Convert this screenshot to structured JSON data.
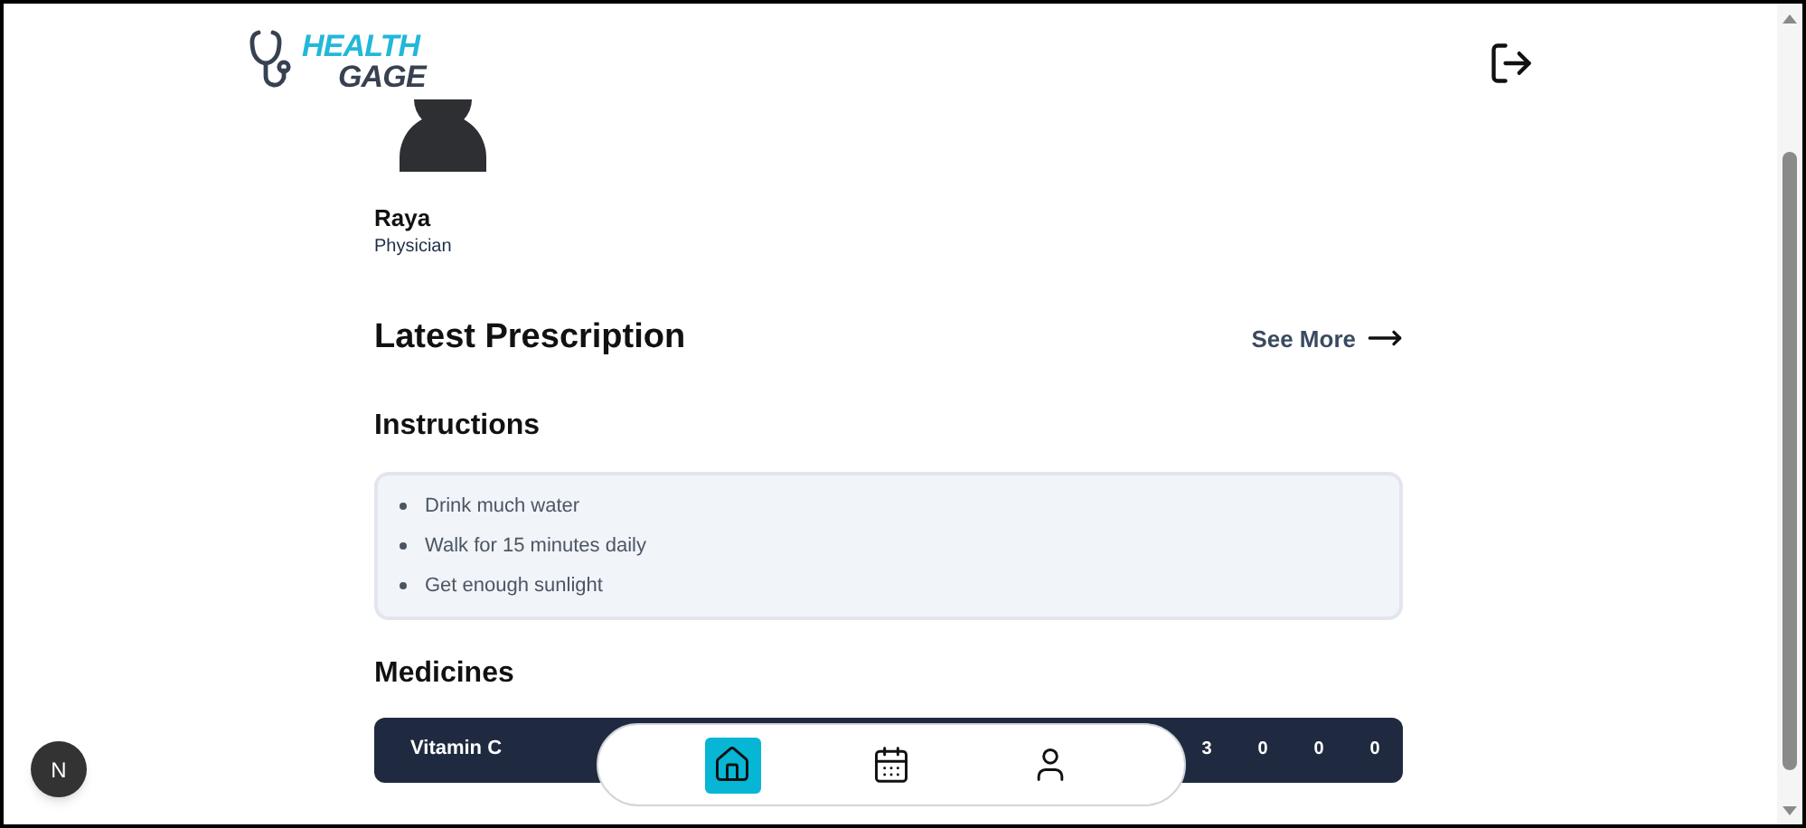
{
  "logo": {
    "line_1": "HEALTH",
    "line_2": "GAGE"
  },
  "profile": {
    "name": "Raya",
    "role": "Physician"
  },
  "prescription": {
    "title": "Latest Prescription",
    "see_more": "See More"
  },
  "instructions": {
    "title": "Instructions",
    "items": [
      "Drink much water",
      "Walk for 15 minutes daily",
      "Get enough sunlight"
    ]
  },
  "medicines": {
    "title": "Medicines",
    "rows": [
      {
        "name": "Vitamin C",
        "values": [
          "3",
          "0",
          "0",
          "0"
        ]
      }
    ]
  },
  "bottom_nav": [
    {
      "kind": "home",
      "selected": true
    },
    {
      "kind": "calendar",
      "selected": false
    },
    {
      "kind": "profile",
      "selected": false
    }
  ],
  "dev_badge": "N"
}
